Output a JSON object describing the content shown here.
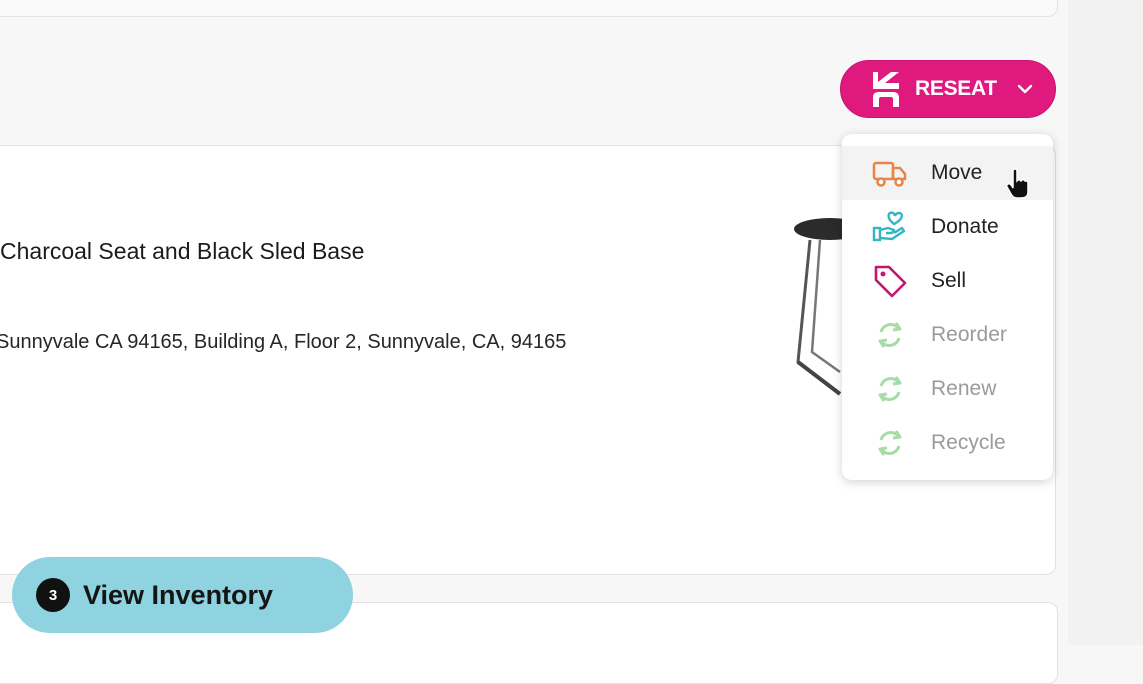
{
  "item": {
    "title": "Charcoal Seat and Black Sled Base",
    "address": "Sunnyvale CA 94165, Building A, Floor 2, Sunnyvale, CA, 94165"
  },
  "reseat_button": {
    "label": "RESEAT",
    "color": "#e0197f"
  },
  "menu": {
    "items": [
      {
        "label": "Move",
        "icon": "truck-icon",
        "color": "#e8834a",
        "state": "hovered"
      },
      {
        "label": "Donate",
        "icon": "heart-hand-icon",
        "color": "#33b5c5",
        "state": "enabled"
      },
      {
        "label": "Sell",
        "icon": "tag-icon",
        "color": "#c4166f",
        "state": "enabled"
      },
      {
        "label": "Reorder",
        "icon": "refresh-icon",
        "color": "#a6dca6",
        "state": "disabled"
      },
      {
        "label": "Renew",
        "icon": "refresh-icon",
        "color": "#a6dca6",
        "state": "disabled"
      },
      {
        "label": "Recycle",
        "icon": "refresh-icon",
        "color": "#a6dca6",
        "state": "disabled"
      }
    ]
  },
  "view_inventory": {
    "step": "3",
    "label": "View Inventory",
    "color": "#8ed3df"
  }
}
